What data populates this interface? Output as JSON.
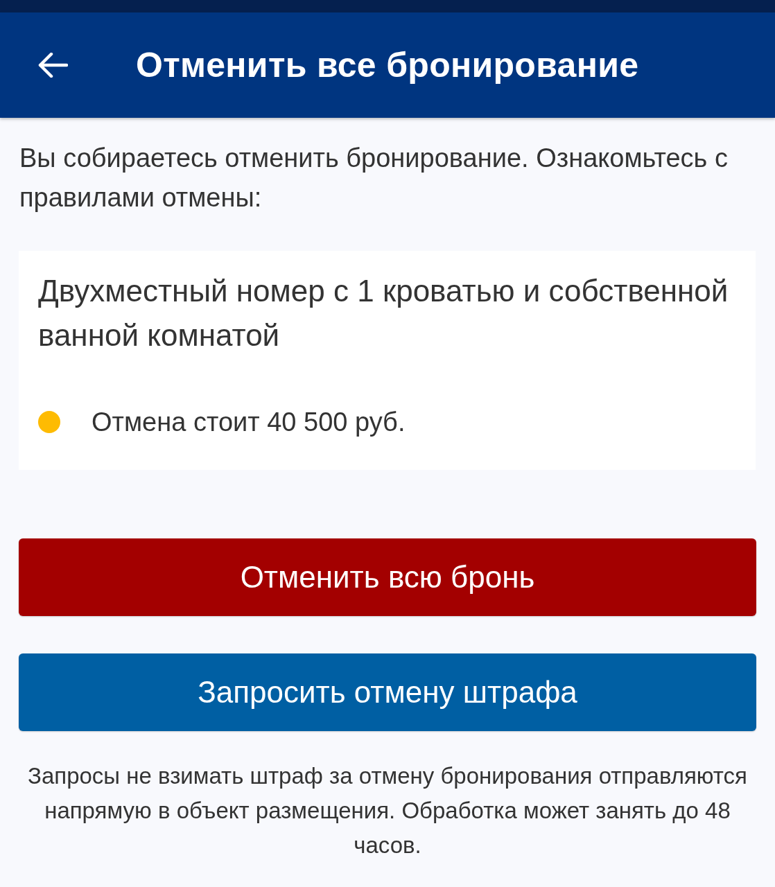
{
  "app_bar": {
    "title": "Отменить все бронирование"
  },
  "intro": "Вы собираетесь отменить бронирование. Ознакомьтесь с правилами отмены:",
  "room": {
    "name": "Двухместный номер с 1 кроватью и собственной ванной комнатой",
    "policies": [
      {
        "text": "Отмена стоит 40 500 руб.",
        "color": "#febb02"
      }
    ]
  },
  "buttons": [
    {
      "label": "Отменить всю бронь",
      "kind": "danger"
    },
    {
      "label": "Запросить отмену штрафа",
      "kind": "primary"
    }
  ],
  "note": "Запросы не взимать штраф за отмену бронирования отправляются напрямую в объект размещения. Обработка может занять до 48 часов."
}
